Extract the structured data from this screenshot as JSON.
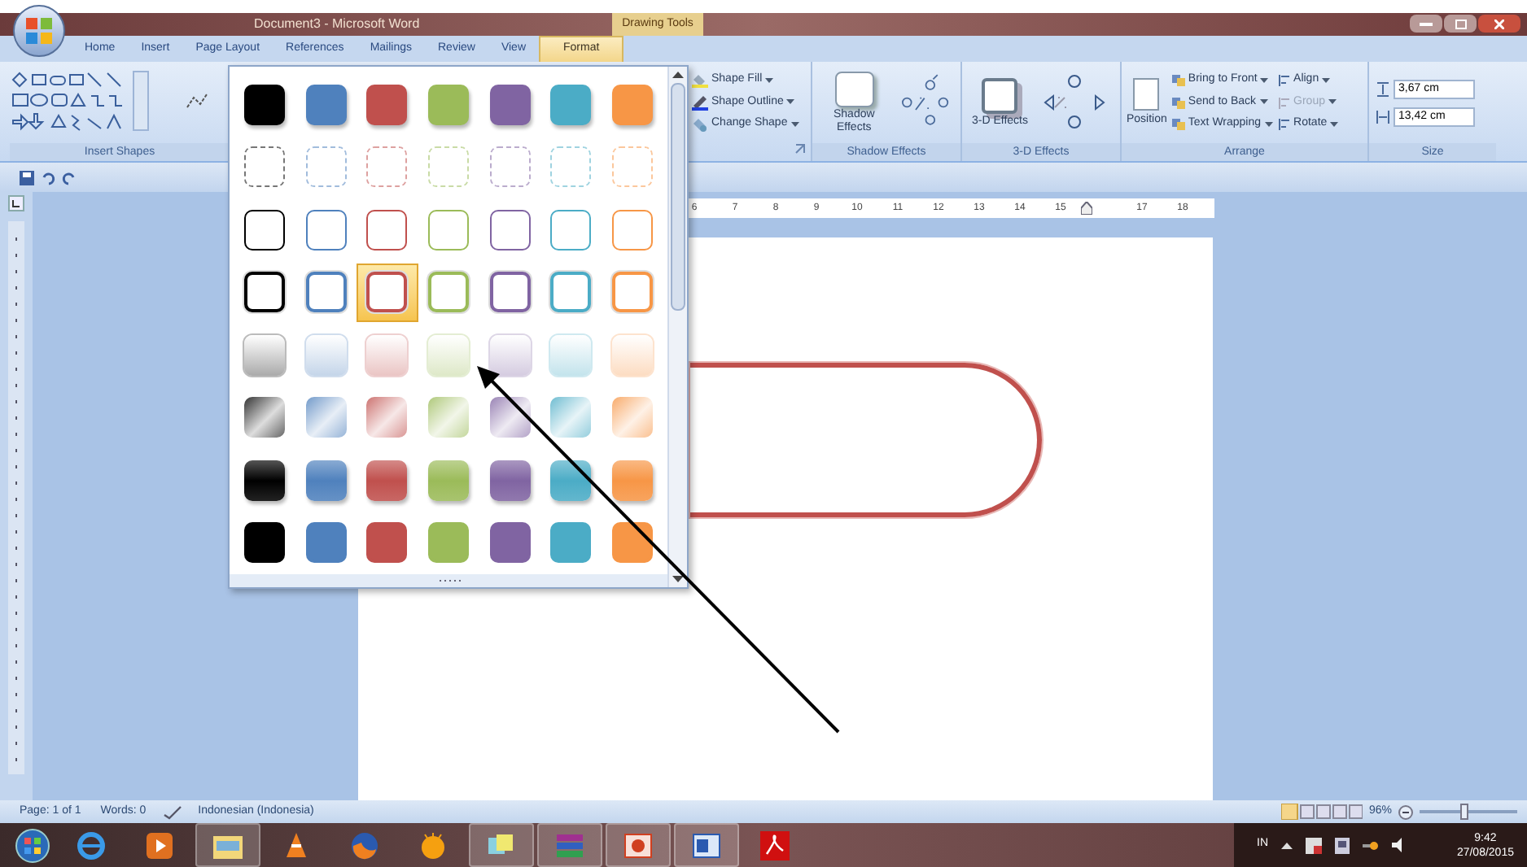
{
  "window": {
    "title": "Document3 - Microsoft Word",
    "context_tab": "Drawing Tools"
  },
  "tabs": [
    {
      "label": "Home",
      "selected": false
    },
    {
      "label": "Insert",
      "selected": false
    },
    {
      "label": "Page Layout",
      "selected": false
    },
    {
      "label": "References",
      "selected": false
    },
    {
      "label": "Mailings",
      "selected": false
    },
    {
      "label": "Review",
      "selected": false
    },
    {
      "label": "View",
      "selected": false
    },
    {
      "label": "Format",
      "selected": true
    }
  ],
  "ribbon": {
    "insert_shapes": {
      "label": "Insert Shapes"
    },
    "shape_styles": [
      {
        "label": "Shape Fill",
        "kind": "fill"
      },
      {
        "label": "Shape Outline",
        "kind": "outline"
      },
      {
        "label": "Change Shape",
        "kind": "change"
      }
    ],
    "shadow_effects": {
      "button": "Shadow Effects",
      "label": "Shadow Effects"
    },
    "three_d_effects": {
      "button": "3-D Effects",
      "label": "3-D Effects"
    },
    "arrange": {
      "position": "Position",
      "left": [
        "Bring to Front",
        "Send to Back",
        "Text Wrapping"
      ],
      "right": [
        {
          "label": "Align",
          "disabled": false
        },
        {
          "label": "Group",
          "disabled": true
        },
        {
          "label": "Rotate",
          "disabled": false
        }
      ],
      "label": "Arrange"
    },
    "size": {
      "height": "3,67 cm",
      "width": "13,42 cm",
      "label": "Size"
    }
  },
  "gallery": {
    "columns": [
      {
        "color": "#000000"
      },
      {
        "color": "#4f81bd"
      },
      {
        "color": "#c0504d"
      },
      {
        "color": "#9bbb59"
      },
      {
        "color": "#8064a2"
      },
      {
        "color": "#4bacc6"
      },
      {
        "color": "#f79646"
      }
    ],
    "rows": [
      {
        "kind": "solid",
        "cells": [
          {
            "selected": false
          },
          {
            "selected": false
          },
          {
            "selected": false
          },
          {
            "selected": false
          },
          {
            "selected": false
          },
          {
            "selected": false
          },
          {
            "selected": false
          }
        ]
      },
      {
        "kind": "dashed",
        "cells": [
          {
            "selected": false
          },
          {
            "selected": false
          },
          {
            "selected": false
          },
          {
            "selected": false
          },
          {
            "selected": false
          },
          {
            "selected": false
          },
          {
            "selected": false
          }
        ]
      },
      {
        "kind": "outline",
        "cells": [
          {
            "selected": false
          },
          {
            "selected": false
          },
          {
            "selected": false
          },
          {
            "selected": false
          },
          {
            "selected": false
          },
          {
            "selected": false
          },
          {
            "selected": false
          }
        ]
      },
      {
        "kind": "thick-outline",
        "cells": [
          {
            "selected": false
          },
          {
            "selected": false
          },
          {
            "selected": true
          },
          {
            "selected": false
          },
          {
            "selected": false
          },
          {
            "selected": false
          },
          {
            "selected": false
          }
        ]
      },
      {
        "kind": "light-gradient",
        "cells": [
          {
            "selected": false
          },
          {
            "selected": false
          },
          {
            "selected": false
          },
          {
            "selected": false
          },
          {
            "selected": false
          },
          {
            "selected": false
          },
          {
            "selected": false
          }
        ]
      },
      {
        "kind": "gradient",
        "cells": [
          {
            "selected": false
          },
          {
            "selected": false
          },
          {
            "selected": false
          },
          {
            "selected": false
          },
          {
            "selected": false
          },
          {
            "selected": false
          },
          {
            "selected": false
          }
        ]
      },
      {
        "kind": "glossy",
        "cells": [
          {
            "selected": false
          },
          {
            "selected": false
          },
          {
            "selected": false
          },
          {
            "selected": false
          },
          {
            "selected": false
          },
          {
            "selected": false
          },
          {
            "selected": false
          }
        ]
      },
      {
        "kind": "bordered",
        "cells": [
          {
            "selected": false
          },
          {
            "selected": false
          },
          {
            "selected": false
          },
          {
            "selected": false
          },
          {
            "selected": false
          },
          {
            "selected": false
          },
          {
            "selected": false
          }
        ]
      }
    ]
  },
  "ruler": [
    {
      "kind": "number",
      "label": "6"
    },
    {
      "kind": "number",
      "label": "7"
    },
    {
      "kind": "number",
      "label": "8"
    },
    {
      "kind": "number",
      "label": "9"
    },
    {
      "kind": "number",
      "label": "10"
    },
    {
      "kind": "number",
      "label": "11"
    },
    {
      "kind": "number",
      "label": "12"
    },
    {
      "kind": "number",
      "label": "13"
    },
    {
      "kind": "number",
      "label": "14"
    },
    {
      "kind": "number",
      "label": "15"
    },
    {
      "kind": "marker"
    },
    {
      "kind": "number",
      "label": "17"
    },
    {
      "kind": "number",
      "label": "18"
    }
  ],
  "status_bar": {
    "page": "Page: 1 of 1",
    "words": "Words: 0",
    "language": "Indonesian (Indonesia)",
    "zoom": "96%",
    "zoom_level": {
      "level": 0.45
    }
  },
  "taskbar": {
    "buttons": [
      {
        "running": false
      },
      {
        "running": false
      },
      {
        "running": true
      },
      {
        "running": false
      },
      {
        "running": false
      },
      {
        "running": false
      },
      {
        "running": true
      },
      {
        "running": true
      },
      {
        "running": true
      },
      {
        "running": true
      },
      {
        "running": false
      }
    ],
    "language": "IN",
    "time": "9:42",
    "date": "27/08/2015"
  }
}
